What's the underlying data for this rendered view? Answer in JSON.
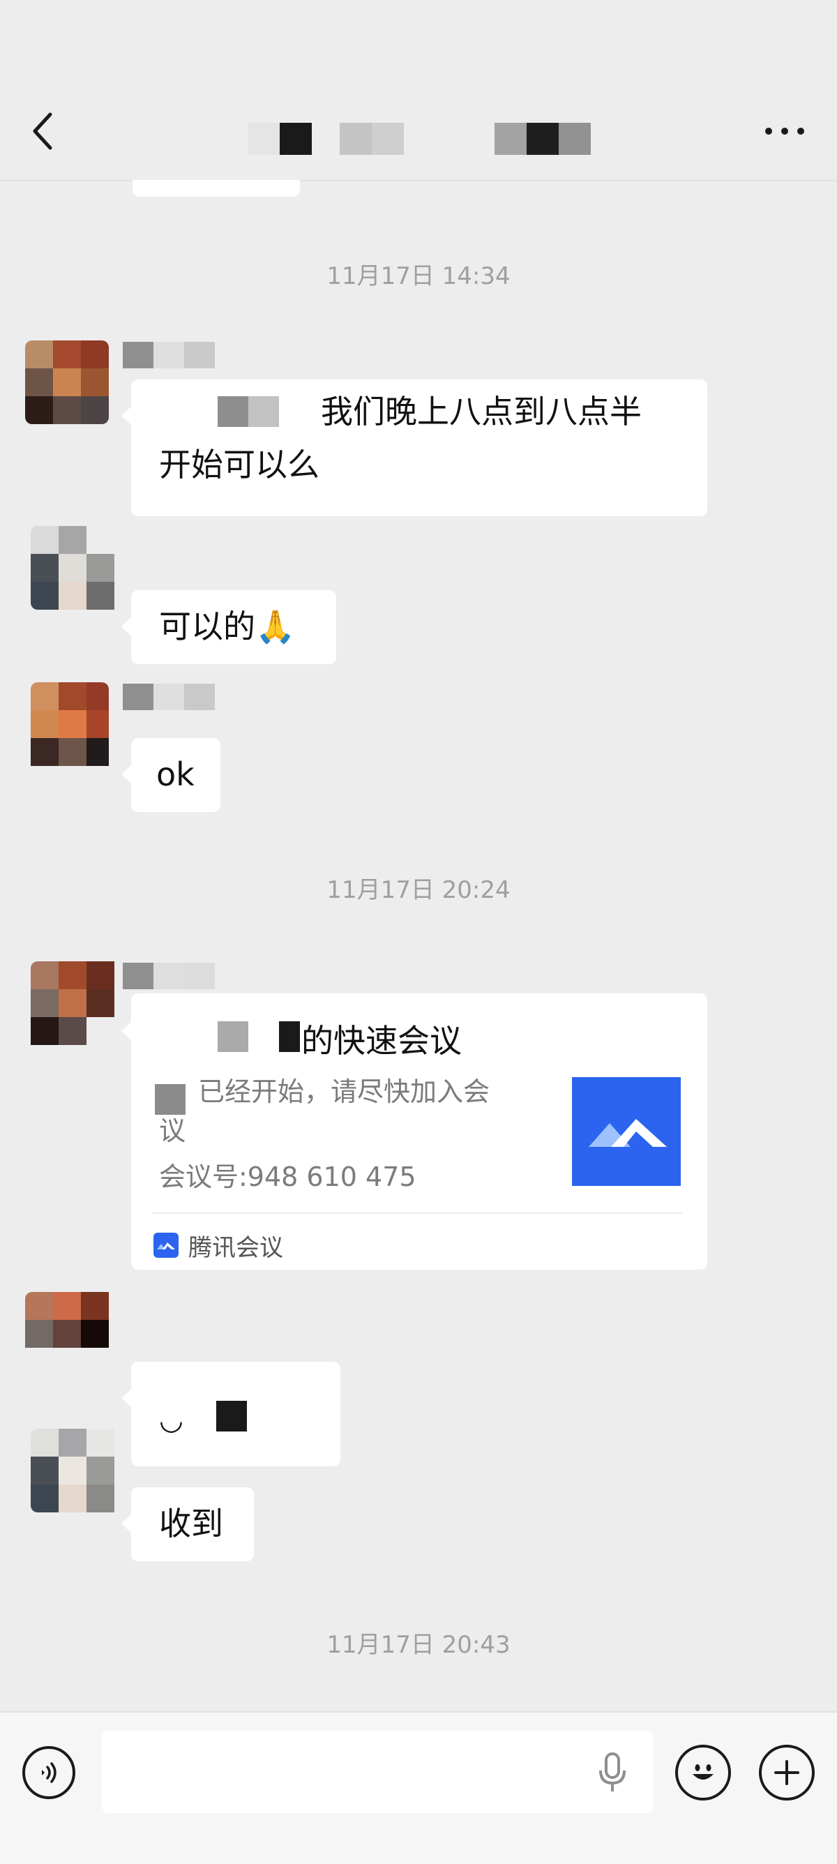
{
  "header": {
    "back_icon": "chevron-left-icon",
    "more_icon": "more-horizontal-icon"
  },
  "messages": {
    "time1": "11月17日 14:34",
    "m1_text_line1": "我们晚上八点到八点半",
    "m1_text_line2": "开始可以么",
    "m2_text": "可以的",
    "m2_emoji": "🙏",
    "m3_text": "ok",
    "time2": "11月17日 20:24",
    "m5_text": "收到",
    "time3": "11月17日 20:43"
  },
  "meeting_card": {
    "title": "的快速会议",
    "desc_line1": "已经开始，请尽快加入会",
    "desc_line2": "议",
    "meeting_id": "会议号:948 610 475",
    "source": "腾讯会议"
  },
  "input_bar": {
    "voice_icon": "voice-icon",
    "emoji_icon": "emoji-icon",
    "plus_icon": "plus-icon",
    "mic_icon": "mic-icon"
  },
  "colors": {
    "background": "#ededed",
    "bubble": "#ffffff",
    "meeting_brand": "#2c64f0"
  }
}
